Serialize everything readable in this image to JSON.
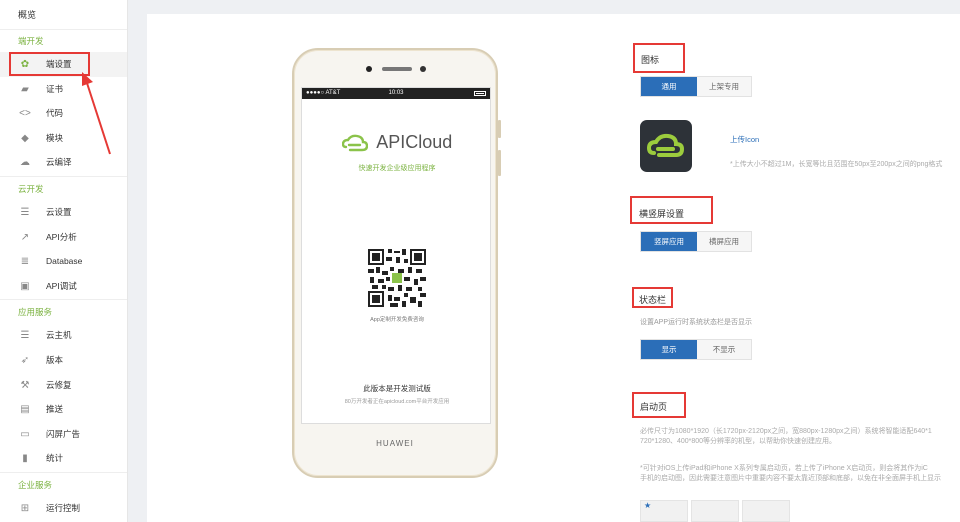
{
  "sidebar": {
    "overview": "概览",
    "sections": [
      {
        "title": "端开发",
        "items": [
          {
            "label": "端设置",
            "icon": "gear-icon",
            "active": true
          },
          {
            "label": "证书",
            "icon": "certificate-icon"
          },
          {
            "label": "代码",
            "icon": "code-icon"
          },
          {
            "label": "模块",
            "icon": "puzzle-icon"
          },
          {
            "label": "云编译",
            "icon": "cloud-icon"
          }
        ]
      },
      {
        "title": "云开发",
        "items": [
          {
            "label": "云设置",
            "icon": "sliders-icon"
          },
          {
            "label": "API分析",
            "icon": "line-chart-icon"
          },
          {
            "label": "Database",
            "icon": "database-icon"
          },
          {
            "label": "API调试",
            "icon": "debug-icon"
          }
        ]
      },
      {
        "title": "应用服务",
        "items": [
          {
            "label": "云主机",
            "icon": "server-icon"
          },
          {
            "label": "版本",
            "icon": "rocket-icon"
          },
          {
            "label": "云修复",
            "icon": "wrench-icon"
          },
          {
            "label": "推送",
            "icon": "push-icon"
          },
          {
            "label": "闪屏广告",
            "icon": "screen-icon"
          },
          {
            "label": "统计",
            "icon": "bar-chart-icon"
          }
        ]
      },
      {
        "title": "企业服务",
        "items": [
          {
            "label": "运行控制",
            "icon": "control-icon"
          }
        ]
      }
    ]
  },
  "phone": {
    "carrier": "●●●●○ AT&T",
    "time": "10:03",
    "app_name": "APICloud",
    "tagline": "快速开发企业级应用程序",
    "qr_caption": "App定制开发免费咨询",
    "dev_title": "此版本是开发测试版",
    "dev_sub": "80万开发者正在apicloud.com平台开发应用",
    "brand": "HUAWEI"
  },
  "settings": {
    "icon": {
      "title": "图标",
      "tabs": [
        "通用",
        "上架专用"
      ],
      "upload": "上传Icon",
      "hint": "*上传大小不超过1M，长宽等比且范围在50px至200px之间的png格式"
    },
    "orientation": {
      "title": "横竖屏设置",
      "tabs": [
        "竖屏应用",
        "横屏应用"
      ]
    },
    "statusbar": {
      "title": "状态栏",
      "desc": "设置APP运行时系统状态栏是否显示",
      "tabs": [
        "显示",
        "不显示"
      ]
    },
    "launch": {
      "title": "启动页",
      "hint1": "必传尺寸为1080*1920（长1720px-2120px之间，宽880px-1280px之间）系统将智能适配640*1",
      "hint2": "720*1280、400*800等分辨率的机型，以帮助你快速创建应用。",
      "hint3": "*可针对iOS上传iPad和iPhone X系列专属启动页，若上传了iPhone X启动页，则会将其作为iC",
      "hint4": "手机的启动图，因此需要注意图片中重要内容不要太靠近顶部和底部，以免在非全面屏手机上显示"
    }
  },
  "colors": {
    "accent_green": "#7cb342",
    "accent_blue": "#2b6eb8",
    "highlight_red": "#e53935"
  }
}
